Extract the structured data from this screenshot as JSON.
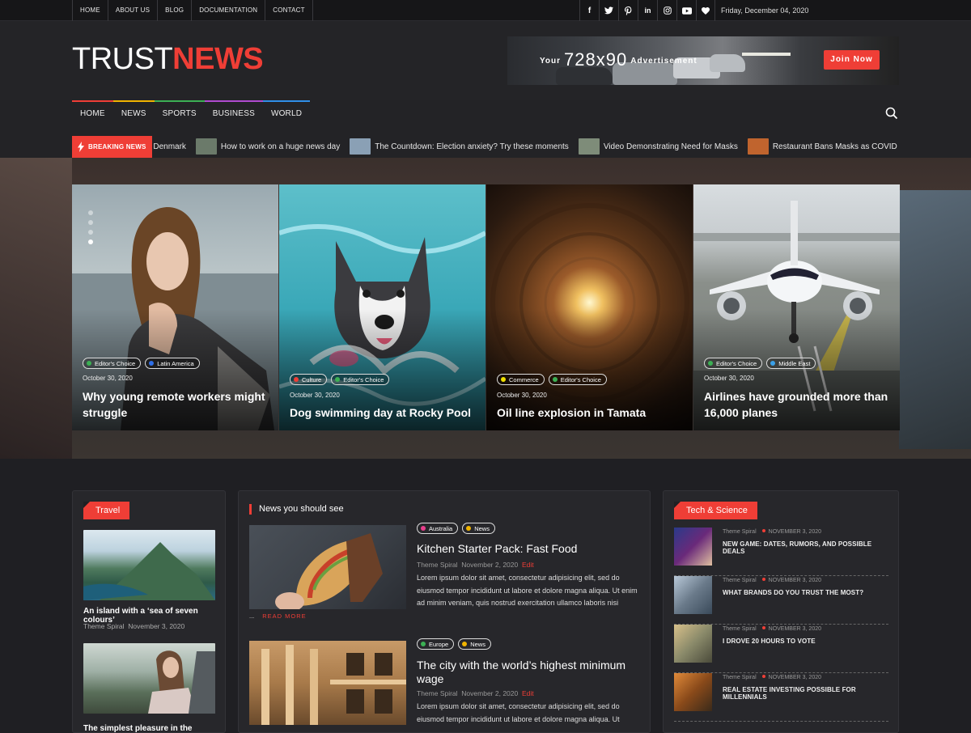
{
  "top_nav": [
    "HOME",
    "ABOUT US",
    "BLOG",
    "DOCUMENTATION",
    "CONTACT"
  ],
  "social_icons": [
    "facebook-icon",
    "twitter-icon",
    "pinterest-icon",
    "linkedin-icon",
    "instagram-icon",
    "youtube-icon",
    "heart-icon"
  ],
  "social_glyphs": [
    "f",
    "t",
    "p",
    "in",
    "◎",
    "▶",
    "♥"
  ],
  "date": "Friday, December 04, 2020",
  "logo": {
    "part1": "TRUST",
    "part2": "NEWS"
  },
  "ad": {
    "your": "Your",
    "size": "728x90",
    "advertisement": "Advertisement",
    "button": "Join Now"
  },
  "main_nav": [
    {
      "label": "HOME",
      "color": "#ef3e36"
    },
    {
      "label": "NEWS",
      "color": "#f0b400"
    },
    {
      "label": "SPORTS",
      "color": "#3cb054"
    },
    {
      "label": "BUSINESS",
      "color": "#b04bd0"
    },
    {
      "label": "WORLD",
      "color": "#2f8fe8"
    }
  ],
  "breaking": {
    "label": "BREAKING NEWS",
    "items": [
      {
        "text": "Events Denmark",
        "thumb": "#555"
      },
      {
        "text": "How to work on a huge news day",
        "thumb": "#6b7a6a"
      },
      {
        "text": "The Countdown: Election anxiety? Try these moments",
        "thumb": "#8aa0b5"
      },
      {
        "text": "Video Demonstrating Need for Masks",
        "thumb": "#7e8c79"
      },
      {
        "text": "Restaurant Bans Masks as COVID Cases",
        "thumb": "#c0642e"
      }
    ]
  },
  "hero_cards": [
    {
      "tags": [
        {
          "label": "Editor's Choice",
          "color": "#3cb054"
        },
        {
          "label": "Latin America",
          "color": "#2f6fe8"
        }
      ],
      "date": "October 30, 2020",
      "title": "Why young remote workers might struggle"
    },
    {
      "tags": [
        {
          "label": "Culture",
          "color": "#ef3e36"
        },
        {
          "label": "Editor's Choice",
          "color": "#3cb054"
        }
      ],
      "date": "October 30, 2020",
      "title": "Dog swimming day at Rocky Pool"
    },
    {
      "tags": [
        {
          "label": "Commerce",
          "color": "#f0e000"
        },
        {
          "label": "Editor's Choice",
          "color": "#3cb054"
        }
      ],
      "date": "October 30, 2020",
      "title": "Oil line explosion in Tamata"
    },
    {
      "tags": [
        {
          "label": "Editor's Choice",
          "color": "#3cb054"
        },
        {
          "label": "Middle East",
          "color": "#3aa0e8"
        }
      ],
      "date": "October 30, 2020",
      "title": "Airlines have grounded more than 16,000 planes"
    }
  ],
  "travel": {
    "heading": "Travel",
    "items": [
      {
        "title": "An island with a ‘sea of seven colours’",
        "author": "Theme Spiral",
        "date": "November 3, 2020"
      },
      {
        "title": "The simplest pleasure in the"
      }
    ]
  },
  "news": {
    "heading": "News you should see",
    "read_more": "READ MORE",
    "read_more_prefix": "...",
    "items": [
      {
        "tags": [
          {
            "label": "Australia",
            "color": "#e83e8c"
          },
          {
            "label": "News",
            "color": "#f0b400"
          }
        ],
        "title": "Kitchen Starter Pack: Fast Food",
        "author": "Theme Spiral",
        "date": "November 2, 2020",
        "edit": "Edit",
        "excerpt": "Lorem ipsum dolor sit amet, consectetur adipisicing elit, sed do eiusmod tempor incididunt ut labore et dolore magna aliqua. Ut enim ad minim veniam, quis nostrud exercitation ullamco laboris nisi"
      },
      {
        "tags": [
          {
            "label": "Europe",
            "color": "#3cb054"
          },
          {
            "label": "News",
            "color": "#f0b400"
          }
        ],
        "title": "The city with the world’s highest minimum wage",
        "author": "Theme Spiral",
        "date": "November 2, 2020",
        "edit": "Edit",
        "excerpt": "Lorem ipsum dolor sit amet, consectetur adipisicing elit, sed do eiusmod tempor incididunt ut labore et dolore magna aliqua. Ut"
      }
    ]
  },
  "tech": {
    "heading": "Tech & Science",
    "items": [
      {
        "author": "Theme Spiral",
        "date": "NOVEMBER 3, 2020",
        "title": "NEW GAME: DATES, RUMORS, AND POSSIBLE DEALS"
      },
      {
        "author": "Theme Spiral",
        "date": "NOVEMBER 3, 2020",
        "title": "WHAT BRANDS DO YOU TRUST THE MOST?"
      },
      {
        "author": "Theme Spiral",
        "date": "NOVEMBER 3, 2020",
        "title": "I DROVE 20 HOURS TO VOTE"
      },
      {
        "author": "Theme Spiral",
        "date": "NOVEMBER 3, 2020",
        "title": "REAL ESTATE INVESTING POSSIBLE FOR MILLENNIALS"
      }
    ]
  },
  "accent_color": "#ef3e36"
}
